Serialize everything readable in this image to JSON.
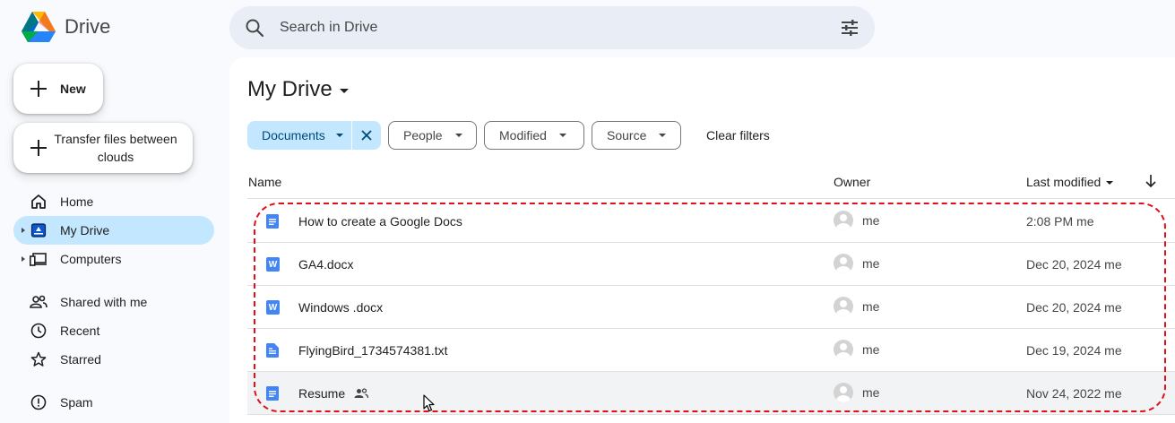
{
  "app": {
    "name": "Drive"
  },
  "search": {
    "placeholder": "Search in Drive"
  },
  "sidebar": {
    "new_label": "New",
    "transfer_label": "Transfer files between clouds",
    "items": [
      {
        "label": "Home",
        "icon": "home-icon"
      },
      {
        "label": "My Drive",
        "icon": "my-drive-icon",
        "active": true
      },
      {
        "label": "Computers",
        "icon": "computers-icon"
      },
      {
        "label": "Shared with me",
        "icon": "shared-icon"
      },
      {
        "label": "Recent",
        "icon": "clock-icon"
      },
      {
        "label": "Starred",
        "icon": "star-icon"
      },
      {
        "label": "Spam",
        "icon": "spam-icon"
      }
    ]
  },
  "main": {
    "title": "My Drive",
    "filters": {
      "active": "Documents",
      "chips": [
        "People",
        "Modified",
        "Source"
      ],
      "clear": "Clear filters"
    },
    "columns": {
      "name": "Name",
      "owner": "Owner",
      "modified": "Last modified"
    },
    "files": [
      {
        "name": "How to create a Google Docs",
        "type": "google-doc",
        "owner": "me",
        "modified": "2:08 PM me"
      },
      {
        "name": "GA4.docx",
        "type": "word",
        "owner": "me",
        "modified": "Dec 20, 2024 me"
      },
      {
        "name": "Windows .docx",
        "type": "word",
        "owner": "me",
        "modified": "Dec 20, 2024 me"
      },
      {
        "name": "FlyingBird_1734574381.txt",
        "type": "text",
        "owner": "me",
        "modified": "Dec 19, 2024 me"
      },
      {
        "name": "Resume",
        "type": "google-doc",
        "shared": true,
        "owner": "me",
        "modified": "Nov 24, 2022 me"
      }
    ]
  },
  "colors": {
    "accent": "#c2e7ff",
    "search_bg": "#e9eef6",
    "doc_blue": "#4285f4",
    "highlight": "#e0101a"
  }
}
